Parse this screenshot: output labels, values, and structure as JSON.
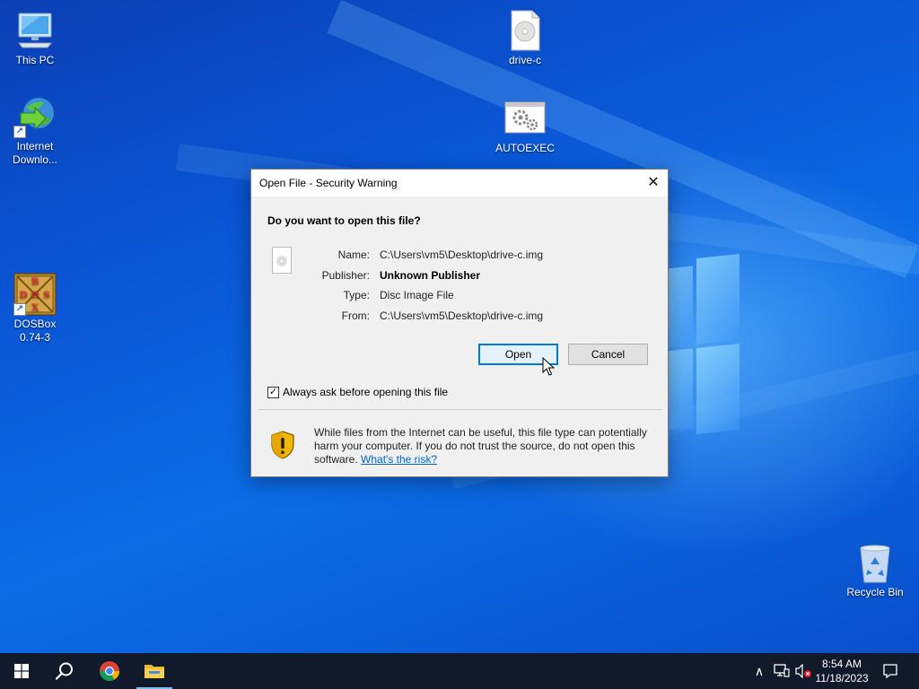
{
  "desktop": {
    "icons": {
      "this_pc": "This PC",
      "idm": "Internet Downlo...",
      "dosbox": "DOSBox 0.74-3",
      "drive_c": "drive-c",
      "autoexec": "AUTOEXEC",
      "recycle_bin": "Recycle Bin"
    },
    "dosbox_glyph_letters": [
      "B",
      "D",
      "O",
      "S",
      "X"
    ]
  },
  "dialog": {
    "title": "Open File - Security Warning",
    "close_glyph": "✕",
    "question": "Do you want to open this file?",
    "fields": {
      "name_label": "Name:",
      "name_value": "C:\\Users\\vm5\\Desktop\\drive-c.img",
      "publisher_label": "Publisher:",
      "publisher_value": "Unknown Publisher",
      "type_label": "Type:",
      "type_value": "Disc Image File",
      "from_label": "From:",
      "from_value": "C:\\Users\\vm5\\Desktop\\drive-c.img"
    },
    "buttons": {
      "open": "Open",
      "cancel": "Cancel"
    },
    "checkbox": {
      "label": "Always ask before opening this file",
      "checked": true,
      "check_glyph": "✓"
    },
    "warning": {
      "text": "While files from the Internet can be useful, this file type can potentially harm your computer. If you do not trust the source, do not open this software.",
      "link": "What's the risk?"
    }
  },
  "taskbar": {
    "clock_time": "8:54 AM",
    "clock_date": "11/18/2023",
    "tray_chevron": "∧"
  },
  "icons": {
    "start": "windows-logo-icon",
    "search": "search-icon",
    "chrome": "chrome-icon",
    "explorer": "folder-icon",
    "network": "network-icon",
    "volume": "volume-muted-icon",
    "notifications": "notification-icon",
    "shield": "shield-warning-icon"
  },
  "colors": {
    "accent": "#0078d7",
    "link": "#0066cc",
    "taskbar": "#101a2a"
  }
}
